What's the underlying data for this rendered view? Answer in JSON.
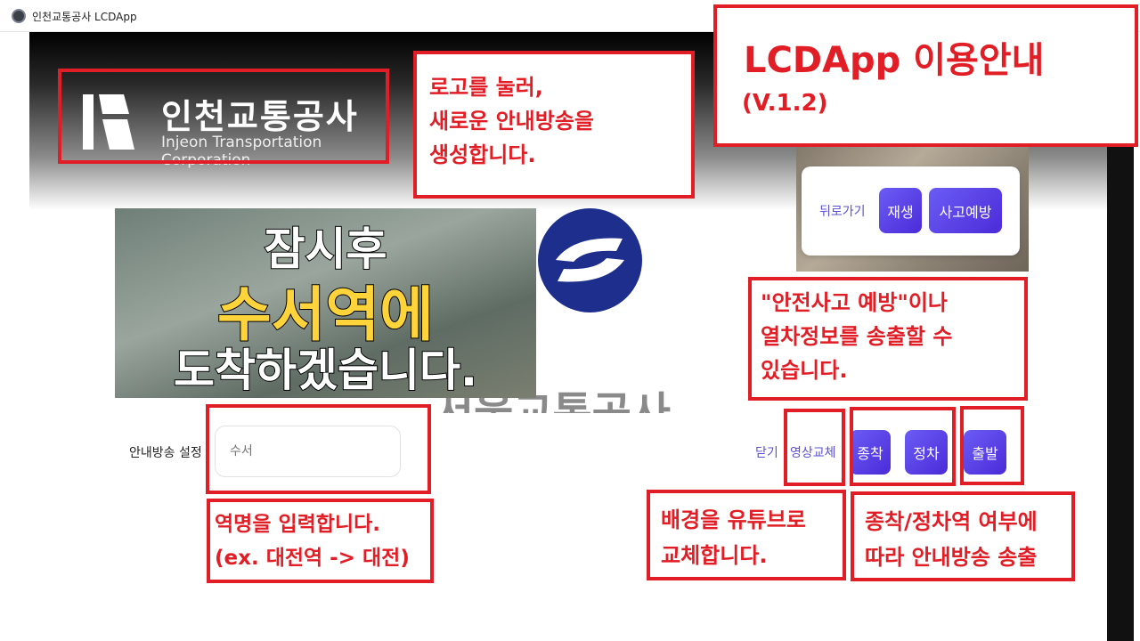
{
  "window": {
    "title": "인천교통공사 LCDApp"
  },
  "logo": {
    "name_ko": "인천교통공사",
    "name_en": "Injeon Transportation Corporation"
  },
  "player_controls": {
    "back_label": "뒤로가기",
    "play_label": "재생",
    "prevention_label": "사고예방"
  },
  "announcement": {
    "line1": "잠시후",
    "line2": "수서역에",
    "line3": "도착하겠습니다."
  },
  "brand_text": "서울교통공사",
  "settings": {
    "label": "안내방송 설정",
    "station_placeholder": "수서"
  },
  "actions": {
    "close_label": "닫기",
    "change_video_label": "영상교체",
    "terminal_label": "종착",
    "stop_label": "정차",
    "depart_label": "출발"
  },
  "callouts": {
    "title": "LCDApp 이용안내",
    "version": "(V.1.2)",
    "logo_help": [
      "로고를 눌러,",
      "새로운 안내방송을",
      "생성합니다."
    ],
    "control_help": [
      "\"안전사고 예방\"이나",
      "열차정보를 송출할 수",
      "있습니다."
    ],
    "station_help": [
      "역명을 입력합니다.",
      "(ex. 대전역 -> 대전)"
    ],
    "video_help": [
      "배경을 유튜브로",
      "교체합니다."
    ],
    "stop_help": [
      "종착/정차역 여부에",
      "따라 안내방송 송출"
    ]
  },
  "colors": {
    "accent": "#e11d25",
    "button_gradient_start": "#6b5cf5",
    "button_gradient_end": "#4b2bd8",
    "link": "#5a50d8",
    "highlight": "#ffd43b"
  }
}
